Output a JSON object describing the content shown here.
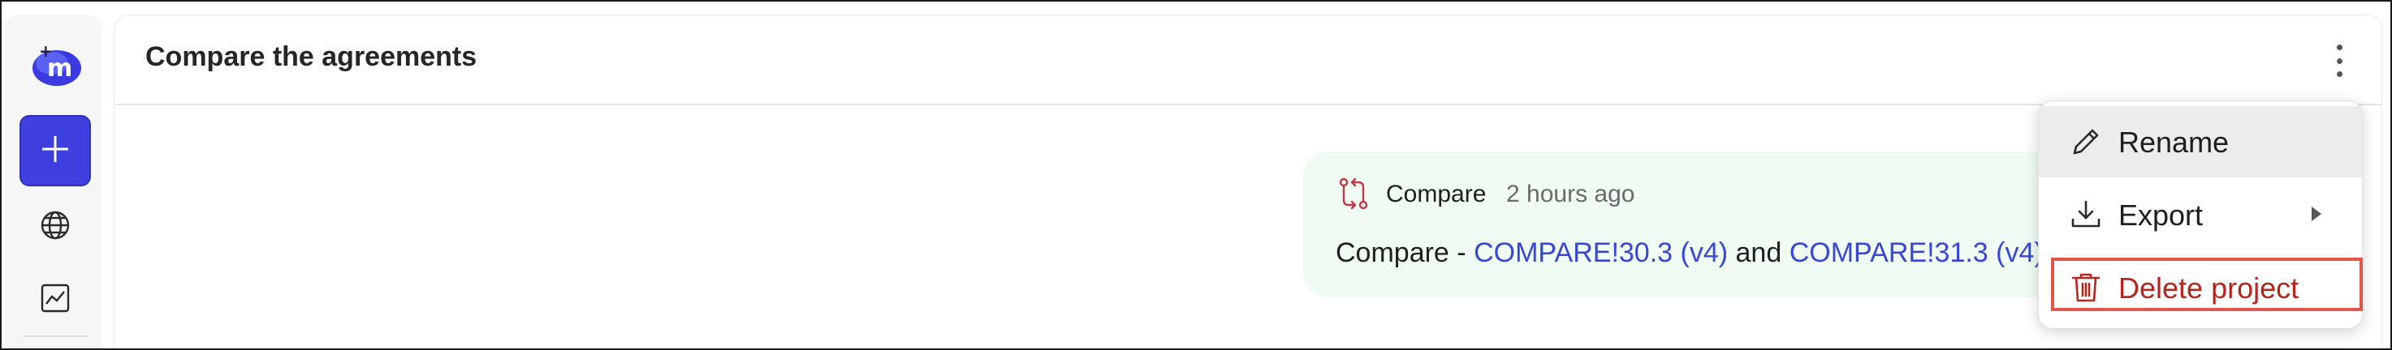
{
  "app": {
    "sidebar": {
      "logo": "m-logo",
      "new_button_icon": "plus-icon",
      "items": [
        {
          "name": "globe",
          "icon": "globe-icon"
        },
        {
          "name": "analytics",
          "icon": "chart-icon"
        }
      ]
    },
    "header": {
      "title": "Compare the agreements",
      "more_icon": "kebab-icon"
    },
    "message": {
      "icon": "compare-arrows-icon",
      "type": "Compare",
      "time": "2 hours ago",
      "prefix": "Compare - ",
      "link1": "COMPARE!30.3 (v4)",
      "connector": " and ",
      "link2": "COMPARE!31.3 (v4)"
    },
    "menu": {
      "items": [
        {
          "label": "Rename",
          "icon": "pencil-icon"
        },
        {
          "label": "Export",
          "icon": "download-icon",
          "submenu_icon": "caret-right-icon"
        },
        {
          "label": "Delete project",
          "icon": "trash-icon"
        }
      ]
    },
    "colors": {
      "accent": "#3f3fe0",
      "link": "#3a46d6",
      "danger": "#b3261e",
      "highlight": "#e0564a",
      "card_bg": "#effbf3"
    }
  }
}
